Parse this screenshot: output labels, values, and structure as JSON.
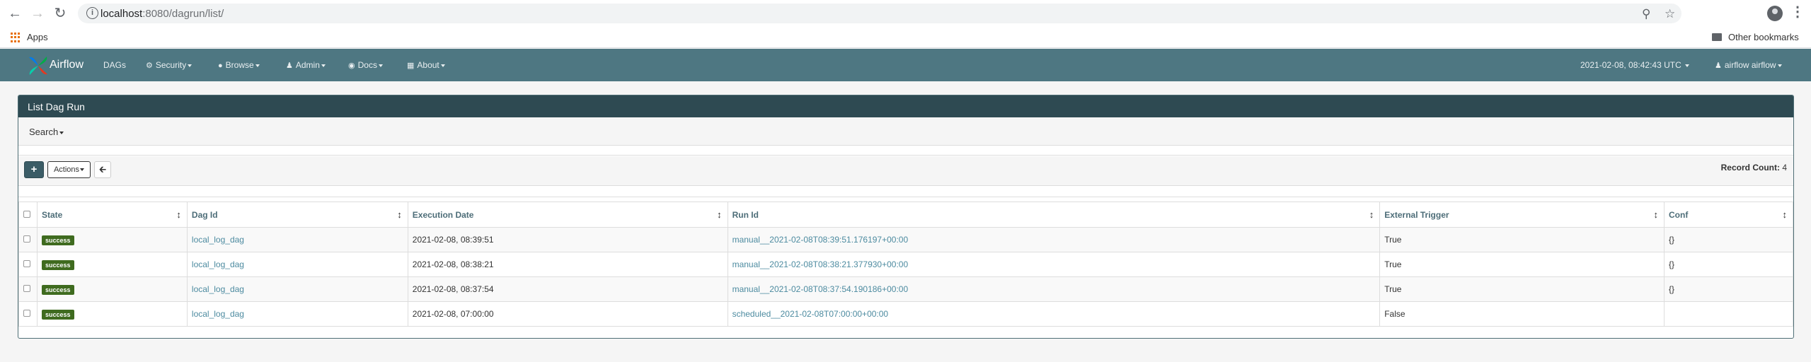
{
  "browser": {
    "url_host": "localhost",
    "url_path": ":8080/dagrun/list/",
    "bookmarks": {
      "apps_label": "Apps",
      "other_label": "Other bookmarks"
    }
  },
  "navbar": {
    "brand": "Airflow",
    "items": [
      {
        "label": "DAGs",
        "icon": ""
      },
      {
        "label": "Security",
        "icon": "cogs-icon"
      },
      {
        "label": "Browse",
        "icon": "globe-icon"
      },
      {
        "label": "Admin",
        "icon": "user-icon"
      },
      {
        "label": "Docs",
        "icon": "lifebuoy-icon"
      },
      {
        "label": "About",
        "icon": "th-icon"
      }
    ],
    "clock": "2021-02-08, 08:42:43 UTC",
    "user": "airflow airflow"
  },
  "panel": {
    "title": "List Dag Run",
    "search_label": "Search",
    "add_button": "+",
    "actions_label": "Actions",
    "back_icon": "arrow-left-icon",
    "record_count_label": "Record Count:",
    "record_count": "4"
  },
  "table": {
    "columns": [
      "State",
      "Dag Id",
      "Execution Date",
      "Run Id",
      "External Trigger",
      "Conf"
    ],
    "rows": [
      {
        "state": "success",
        "dag_id": "local_log_dag",
        "execution_date": "2021-02-08, 08:39:51",
        "run_id": "manual__2021-02-08T08:39:51.176197+00:00",
        "external_trigger": "True",
        "conf": "{}"
      },
      {
        "state": "success",
        "dag_id": "local_log_dag",
        "execution_date": "2021-02-08, 08:38:21",
        "run_id": "manual__2021-02-08T08:38:21.377930+00:00",
        "external_trigger": "True",
        "conf": "{}"
      },
      {
        "state": "success",
        "dag_id": "local_log_dag",
        "execution_date": "2021-02-08, 08:37:54",
        "run_id": "manual__2021-02-08T08:37:54.190186+00:00",
        "external_trigger": "True",
        "conf": "{}"
      },
      {
        "state": "success",
        "dag_id": "local_log_dag",
        "execution_date": "2021-02-08, 07:00:00",
        "run_id": "scheduled__2021-02-08T07:00:00+00:00",
        "external_trigger": "False",
        "conf": ""
      }
    ]
  },
  "colors": {
    "navbar": "#4e7782",
    "panel_head": "#2e4a52",
    "success_badge": "#3f6b1f",
    "link": "#4d8ba0"
  }
}
